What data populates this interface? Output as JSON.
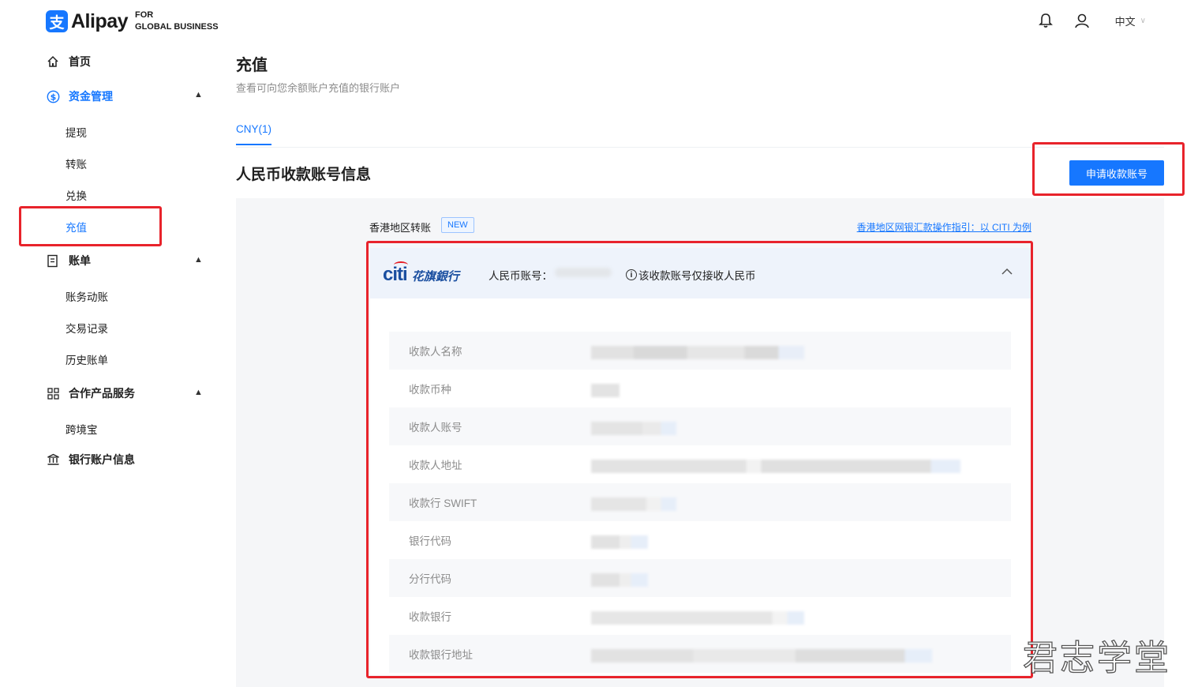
{
  "brand": {
    "mark": "支",
    "name": "Alipay",
    "sub_line1": "FOR",
    "sub_line2": "GLOBAL BUSINESS",
    "accent": "#1677ff"
  },
  "topbar": {
    "language": "中文"
  },
  "sidebar": {
    "home": "首页",
    "funds": {
      "label": "资金管理",
      "items": [
        "提现",
        "转账",
        "兑换",
        "充值"
      ]
    },
    "bills": {
      "label": "账单",
      "items": [
        "账务动账",
        "交易记录",
        "历史账单"
      ]
    },
    "partners": {
      "label": "合作产品服务",
      "items": [
        "跨境宝"
      ]
    },
    "bank_info": "银行账户信息"
  },
  "page": {
    "title": "充值",
    "description": "查看可向您余额账户充值的银行账户",
    "tab": "CNY(1)",
    "section_title": "人民币收款账号信息",
    "apply_button": "申请收款账号"
  },
  "transfer": {
    "region_label": "香港地区转账",
    "badge": "NEW",
    "guide_link": "香港地区网银汇款操作指引：以 CITI 为例"
  },
  "bank_card": {
    "bank_logo_text": "citi",
    "bank_name_cn": "花旗銀行",
    "account_label": "人民币账号：",
    "note": "该收款账号仅接收人民币",
    "fields": [
      "收款人名称",
      "收款币种",
      "收款人账号",
      "收款人地址",
      "收款行 SWIFT",
      "银行代码",
      "分行代码",
      "收款银行",
      "收款银行地址"
    ]
  },
  "watermark": "君志学堂",
  "colors": {
    "highlight": "#e8232b",
    "blurred_value": "#e3e6ea"
  }
}
